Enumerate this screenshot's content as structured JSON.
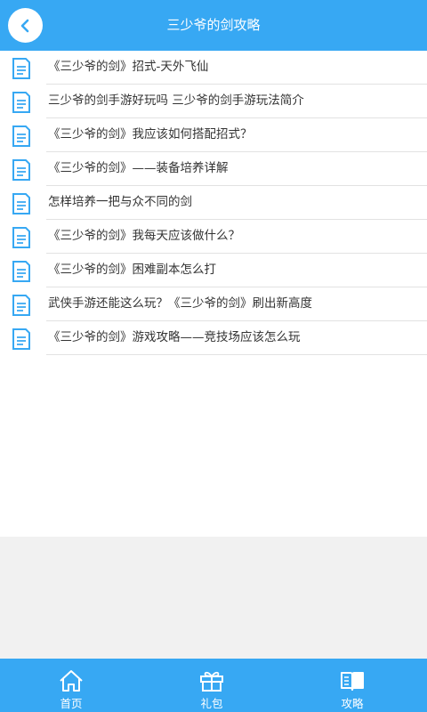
{
  "header": {
    "title": "三少爷的剑攻略",
    "back_icon": "back-arrow-icon"
  },
  "articles": [
    "《三少爷的剑》招式-天外飞仙",
    "三少爷的剑手游好玩吗 三少爷的剑手游玩法简介",
    "《三少爷的剑》我应该如何搭配招式？",
    "《三少爷的剑》——装备培养详解",
    "怎样培养一把与众不同的剑",
    "《三少爷的剑》我每天应该做什么？",
    "《三少爷的剑》困难副本怎么打",
    "武侠手游还能这么玩？《三少爷的剑》刷出新高度",
    "《三少爷的剑》游戏攻略——竞技场应该怎么玩"
  ],
  "tabs": [
    {
      "label": "首页",
      "icon": "home-icon"
    },
    {
      "label": "礼包",
      "icon": "gift-icon"
    },
    {
      "label": "攻略",
      "icon": "book-icon"
    }
  ],
  "colors": {
    "accent": "#37a8f3",
    "background": "#f1f1f1",
    "text": "#333333"
  }
}
